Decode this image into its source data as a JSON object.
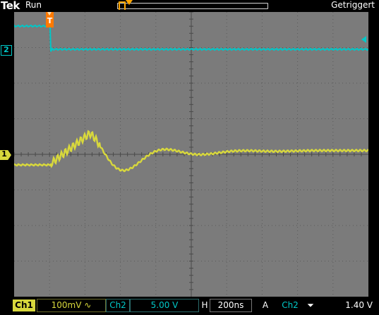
{
  "header": {
    "brand": "Tek",
    "acquisition_state": "Run",
    "trigger_state": "Getriggert"
  },
  "markers": {
    "ch2_marker": "2",
    "ch1_marker": "1",
    "trigger_point": "T"
  },
  "colors": {
    "ch1": "#d8d83c",
    "ch2": "#00c8c8",
    "trigger": "#ffa500",
    "screen_bg": "#7b7b7b",
    "grid": "#5a5a5a"
  },
  "icons": {
    "ch1_coupling": "ac-coupling-icon",
    "trigger_slope": "falling-edge-icon"
  },
  "footer": {
    "ch1_label": "Ch1",
    "ch1_scale": "100mV ∿",
    "ch2_label": "Ch2",
    "ch2_scale": "5.00 V",
    "horizontal_label": "H",
    "horizontal_scale": "200ns",
    "trigger_mode": "A",
    "trigger_source": "Ch2",
    "trigger_slope": "⏷",
    "trigger_level": "1.40 V"
  }
}
